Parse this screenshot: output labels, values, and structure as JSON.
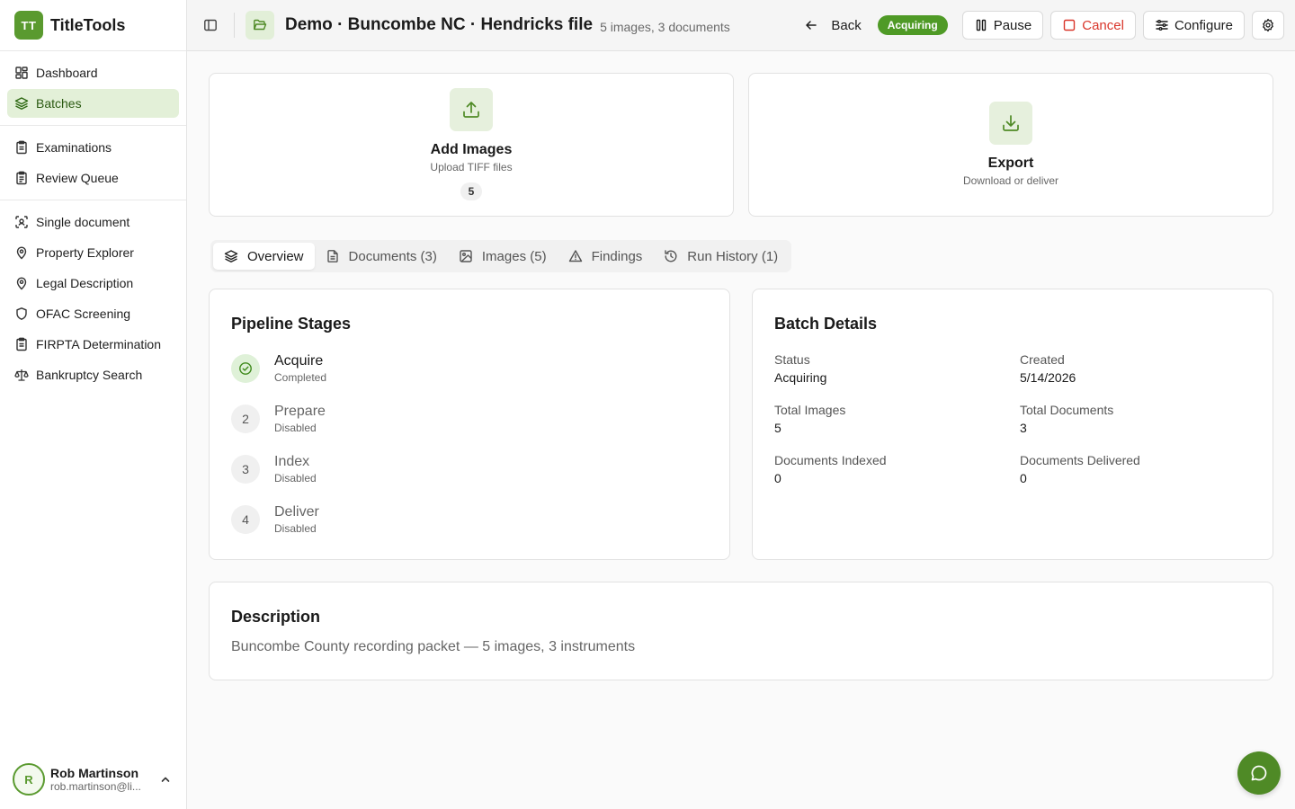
{
  "app": {
    "logo": "TT",
    "name": "TitleTools"
  },
  "sidebar": {
    "groups": [
      [
        {
          "label": "Dashboard",
          "icon": "dashboard-icon"
        },
        {
          "label": "Batches",
          "icon": "layers-icon",
          "active": true
        }
      ],
      [
        {
          "label": "Examinations",
          "icon": "clipboard-icon"
        },
        {
          "label": "Review Queue",
          "icon": "clipboard-list-icon"
        }
      ],
      [
        {
          "label": "Single document",
          "icon": "scan-icon"
        },
        {
          "label": "Property Explorer",
          "icon": "map-pin-icon"
        },
        {
          "label": "Legal Description",
          "icon": "map-pin-icon"
        },
        {
          "label": "OFAC Screening",
          "icon": "shield-icon"
        },
        {
          "label": "FIRPTA Determination",
          "icon": "clipboard-icon"
        },
        {
          "label": "Bankruptcy Search",
          "icon": "scale-icon"
        }
      ]
    ]
  },
  "user": {
    "initial": "R",
    "name": "Rob Martinson",
    "email": "rob.martinson@li..."
  },
  "header": {
    "title": "Demo · Buncombe NC · Hendricks file",
    "subtitle": "5 images, 3 documents",
    "back_label": "Back",
    "status_badge": "Acquiring",
    "pause_label": "Pause",
    "cancel_label": "Cancel",
    "configure_label": "Configure"
  },
  "actions": {
    "add_images": {
      "title": "Add Images",
      "subtitle": "Upload TIFF files",
      "count": "5"
    },
    "export": {
      "title": "Export",
      "subtitle": "Download or deliver"
    }
  },
  "tabs": [
    {
      "label": "Overview",
      "icon": "layers-icon",
      "active": true
    },
    {
      "label": "Documents (3)",
      "icon": "file-icon"
    },
    {
      "label": "Images (5)",
      "icon": "image-icon"
    },
    {
      "label": "Findings",
      "icon": "warning-icon"
    },
    {
      "label": "Run History (1)",
      "icon": "history-icon"
    }
  ],
  "pipeline": {
    "title": "Pipeline Stages",
    "stages": [
      {
        "marker": "",
        "name": "Acquire",
        "status": "Completed",
        "done": true
      },
      {
        "marker": "2",
        "name": "Prepare",
        "status": "Disabled"
      },
      {
        "marker": "3",
        "name": "Index",
        "status": "Disabled"
      },
      {
        "marker": "4",
        "name": "Deliver",
        "status": "Disabled"
      }
    ]
  },
  "batch_details": {
    "title": "Batch Details",
    "fields": [
      {
        "label": "Status",
        "value": "Acquiring"
      },
      {
        "label": "Created",
        "value": "5/14/2026"
      },
      {
        "label": "Total Images",
        "value": "5"
      },
      {
        "label": "Total Documents",
        "value": "3"
      },
      {
        "label": "Documents Indexed",
        "value": "0"
      },
      {
        "label": "Documents Delivered",
        "value": "0"
      }
    ]
  },
  "description": {
    "title": "Description",
    "text": "Buncombe County recording packet — 5 images, 3 instruments"
  },
  "colors": {
    "accent": "#4f9a26",
    "accent_light": "#e3f0d8",
    "danger": "#d9362b"
  }
}
